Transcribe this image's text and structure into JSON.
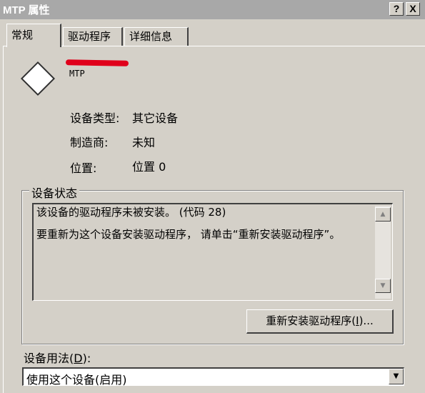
{
  "window": {
    "title": "MTP 属性",
    "help_button": "?",
    "close_button": "X"
  },
  "tabs": [
    {
      "label": "常规",
      "active": true
    },
    {
      "label": "驱动程序",
      "active": false
    },
    {
      "label": "详细信息",
      "active": false
    }
  ],
  "device": {
    "icon": "device-diamond-icon",
    "name": "MTP"
  },
  "properties": [
    {
      "label": "设备类型:",
      "value": "其它设备"
    },
    {
      "label": "制造商:",
      "value": "未知"
    },
    {
      "label": "位置:",
      "value": "位置 0"
    }
  ],
  "status_group": {
    "title": "设备状态",
    "line1": "该设备的驱动程序未被安装。 (代码 28)",
    "line2": "要重新为这个设备安装驱动程序， 请单击“重新安装驱动程序”。",
    "reinstall_button": {
      "text": "重新安装驱动程序",
      "accel": "I",
      "prefix": "(",
      "suffix": ")..."
    }
  },
  "usage": {
    "label_text": "设备用法",
    "label_accel": "D",
    "selected": "使用这个设备(启用)"
  },
  "colors": {
    "redaction_mark": "#e0001b",
    "window_bg": "#d4d0c8"
  }
}
